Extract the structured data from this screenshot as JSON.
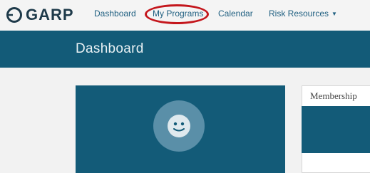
{
  "brand": {
    "name": "GARP",
    "logo_icon": "garp-logo-icon"
  },
  "nav": {
    "items": [
      {
        "label": "Dashboard"
      },
      {
        "label": "My Programs",
        "highlighted": true
      },
      {
        "label": "Calendar"
      },
      {
        "label": "Risk Resources",
        "dropdown": true,
        "dropdown_icon": "caret-down-icon"
      }
    ]
  },
  "header": {
    "title": "Dashboard"
  },
  "profile": {
    "avatar_icon": "smiley-face-icon"
  },
  "membership": {
    "title": "Membership"
  },
  "colors": {
    "brand_dark": "#135b78",
    "nav_link": "#1f5f80",
    "highlight": "#c4161c",
    "avatar_bg": "#5a8fa8"
  }
}
